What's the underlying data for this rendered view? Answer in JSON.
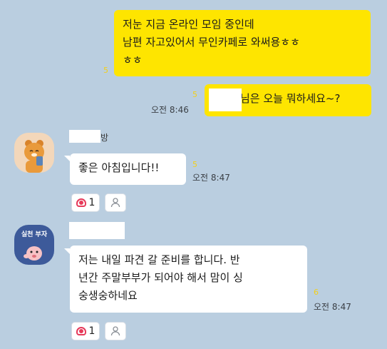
{
  "messages": [
    {
      "id": "m1",
      "lines": [
        "저눈 지금 온라인 모임 중인데",
        "남편 자고있어서 무인카페로 와써용ㅎㅎ",
        "ㅎㅎ"
      ],
      "unread": "5"
    },
    {
      "id": "m2",
      "text": "님은 오늘 뭐하세요~?",
      "unread": "5",
      "time": "오전 8:46"
    },
    {
      "id": "m3",
      "sender_fragment": "방",
      "text": "좋은 아침입니다!!",
      "unread": "5",
      "time": "오전 8:47",
      "reaction": {
        "count": "1",
        "icon": "heart-icon"
      }
    },
    {
      "id": "m4",
      "avatar_text": "실천 부자",
      "lines": [
        "저는 내일 파견 갈 준비를 합니다. 반",
        "년간 주말부부가 되어야 해서 맘이 싱",
        "숭생숭하네요"
      ],
      "unread": "6",
      "time": "오전 8:47",
      "reaction": {
        "count": "1",
        "icon": "heart-icon"
      }
    }
  ],
  "colors": {
    "background": "#bacee0",
    "my_bubble": "#fee500",
    "other_bubble": "#ffffff",
    "unread": "#f2cf1a",
    "heart": "#e63a5a"
  }
}
